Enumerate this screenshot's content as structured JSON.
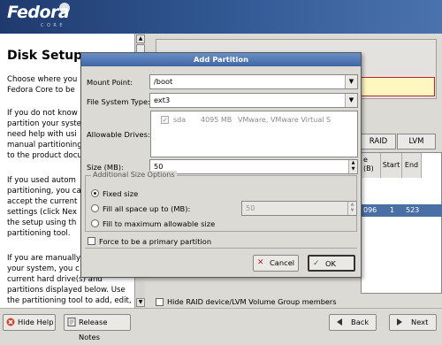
{
  "banner": {
    "brand": "Fedora",
    "sub": "CORE"
  },
  "help": {
    "title": "Disk Setup",
    "paragraphs": [
      "Choose where you\nFedora Core to be",
      "If you do not know\npartition your system\nneed help with usi\nmanual partitioning\nto the product docu",
      "If you used autom\npartitioning, you ca\naccept the current\nsettings (click Nex\nthe setup using th\npartitioning tool.",
      "If you are manually\nyour system, you c\ncurrent hard drive(s) and\npartitions displayed below. Use\nthe partitioning tool to add, edit,"
    ]
  },
  "partition_buttons": {
    "raid": "RAID",
    "lvm": "LVM"
  },
  "partition_table": {
    "columns": [
      "e\n(B)",
      "Start",
      "End"
    ],
    "selected_row": [
      "096",
      "1",
      "523"
    ]
  },
  "hide_raid_label": "Hide RAID device/LVM Volume Group members",
  "bottom": {
    "hide_help": "Hide Help",
    "release_notes": "Release Notes",
    "back": "Back",
    "next": "Next"
  },
  "dialog": {
    "title": "Add Partition",
    "mount_point_label": "Mount Point:",
    "mount_point_value": "/boot",
    "fs_type_label": "File System Type:",
    "fs_type_value": "ext3",
    "allowable_drives_label": "Allowable Drives:",
    "drive": {
      "name": "sda",
      "size": "4095 MB",
      "model": "VMware, VMware Virtual S"
    },
    "size_label": "Size (MB):",
    "size_value": "50",
    "size_options_title": "Additional Size Options",
    "opt_fixed": "Fixed size",
    "opt_fill_upto": "Fill all space up to (MB):",
    "fill_upto_value": "50",
    "opt_fill_max": "Fill to maximum allowable size",
    "primary_label": "Force to be a primary partition",
    "cancel": "Cancel",
    "ok": "OK"
  }
}
